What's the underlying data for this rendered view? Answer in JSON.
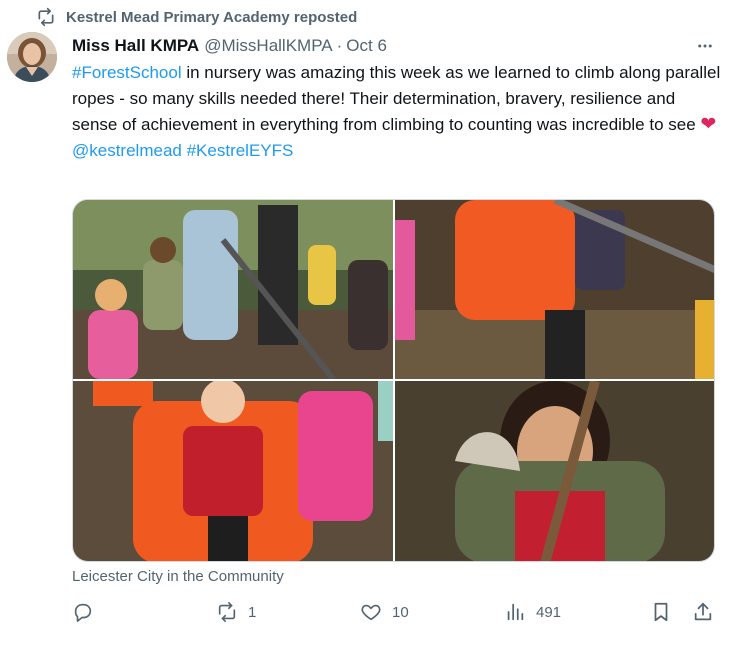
{
  "repost_label": "Kestrel Mead Primary Academy reposted",
  "author": {
    "display_name": "Miss Hall KMPA",
    "handle": "@MissHallKMPA",
    "separator": "·",
    "date": "Oct 6"
  },
  "text": {
    "hashtag_1": "#ForestSchool",
    "body": " in nursery was amazing this week as we learned to climb along parallel ropes - so many skills needed there! Their determination, bravery, resilience and sense of achievement in everything from climbing to counting was incredible to see ",
    "heart": "❤",
    "mention": "@kestrelmead",
    "hashtag_2": "#KestrelEYFS"
  },
  "media_source": "Leicester City in the Community",
  "metrics": {
    "replies": "",
    "reposts": "1",
    "likes": "10",
    "views": "491"
  },
  "icons": {
    "repost_header": "repost-icon",
    "more": "more-icon",
    "reply": "reply-icon",
    "repost": "repost-icon",
    "like": "heart-icon",
    "views": "views-icon",
    "bookmark": "bookmark-icon",
    "share": "share-icon"
  },
  "colors": {
    "link": "#1d9bf0",
    "muted": "#536471",
    "text": "#0f1419",
    "heart": "#e0245e"
  }
}
